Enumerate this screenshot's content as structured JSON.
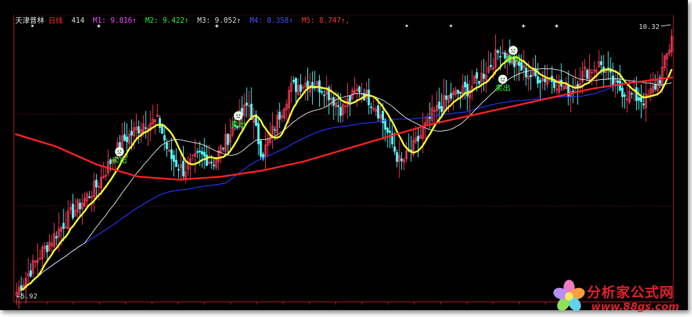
{
  "header": {
    "stock_name": "天津普林",
    "period": "日线",
    "count": "414",
    "ma": [
      {
        "label": "M1:",
        "value": "9.816",
        "arrow": "↑",
        "color": "#ff44ff"
      },
      {
        "label": "M2:",
        "value": "9.422",
        "arrow": "↑",
        "color": "#33ee33"
      },
      {
        "label": "M3:",
        "value": "9.052",
        "arrow": "↑",
        "color": "#dddddd"
      },
      {
        "label": "M4:",
        "value": "8.358",
        "arrow": "↑",
        "color": "#4455ff"
      },
      {
        "label": "M5:",
        "value": "8.747",
        "arrow": "↑",
        "color": "#ff3333"
      }
    ],
    "trailing": ","
  },
  "chart_data": {
    "type": "candlestick",
    "y_range": [
      5.92,
      10.32
    ],
    "high_label": "10.32",
    "low_label": "←5.92",
    "grid": "dotted red horizontal lines",
    "signal_text": "卖出",
    "signal_icon": "smiley-icon",
    "signals_x": [
      173,
      345,
      743,
      728
    ],
    "colors": {
      "up": "#ff3c5a",
      "down": "#55ffff",
      "ma_yellow": "#ffff33",
      "ma_white": "#e8e8e8",
      "ma_blue": "#2a36ff",
      "ma_red": "#ff2222"
    },
    "top_markers": [
      "✷",
      "✚",
      "✚",
      "✷",
      "✷",
      "✚",
      "✚"
    ]
  },
  "watermark": {
    "title": "分析家公式网",
    "url": "www.88gs.com",
    "logo_icon": "flower-logo-icon"
  }
}
